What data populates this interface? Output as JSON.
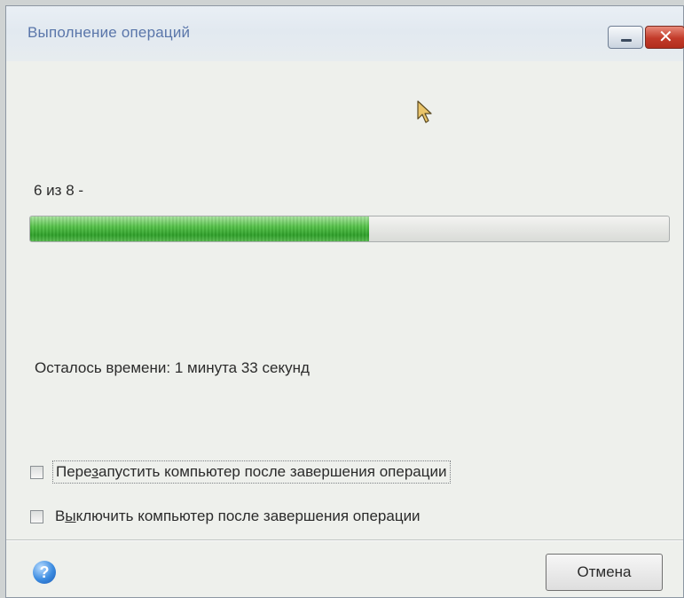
{
  "window": {
    "title": "Выполнение операций",
    "minimize_label": "–",
    "close_label": "✕"
  },
  "operation": {
    "counter": "6 из 8 -",
    "progress": 0.53
  },
  "time_remaining": "Осталось времени: 1 минута 33 секунд",
  "options": [
    {
      "label_pre": "Пере",
      "label_mnemonic": "з",
      "label_post": "апустить компьютер после завершения операции",
      "checked": false
    },
    {
      "label_pre": "В",
      "label_mnemonic": "ы",
      "label_post": "ключить компьютер после завершения операции",
      "checked": false
    }
  ],
  "footer": {
    "help_icon": "help-icon",
    "help_glyph": "?",
    "cancel_label": "Отмена"
  },
  "colors": {
    "progress_fill": "#3fb536",
    "title_text": "#5a76aa",
    "close_button": "#c23b2a"
  }
}
